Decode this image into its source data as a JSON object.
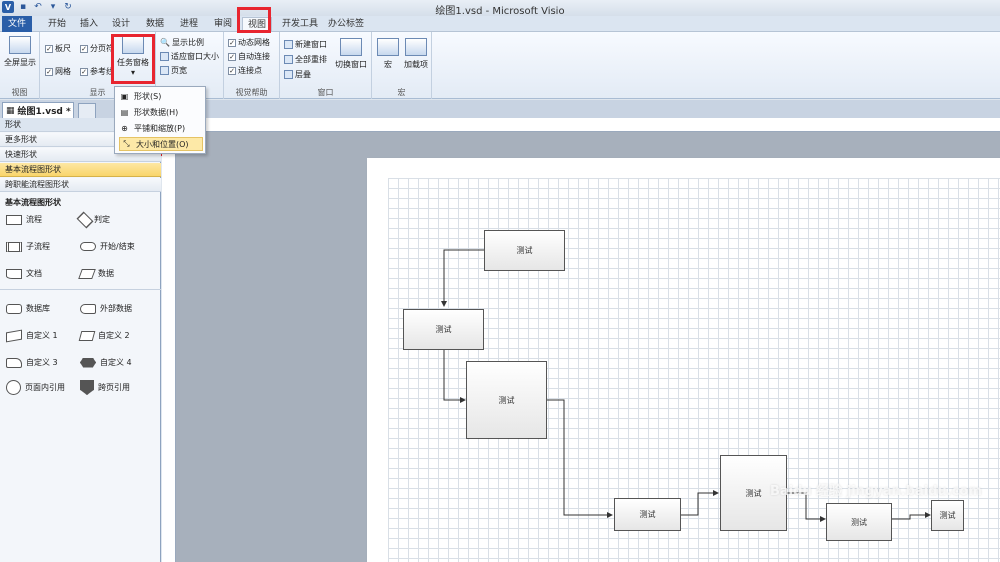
{
  "window": {
    "title": "绘图1.vsd - Microsoft Visio"
  },
  "quick_access": [
    "visio-logo",
    "save-icon",
    "undo-icon",
    "dropdown-icon",
    "redo-icon"
  ],
  "tabs": [
    "文件",
    "开始",
    "插入",
    "设计",
    "数据",
    "进程",
    "审阅",
    "视图",
    "开发工具",
    "办公标签"
  ],
  "active_tab": "视图",
  "ribbon": {
    "view_group": {
      "label": "视图",
      "fullscreen": "全屏显示"
    },
    "show_group": {
      "label": "显示",
      "ruler": "板尺",
      "pagebreak": "分页符",
      "grid": "网格",
      "guides": "参考线"
    },
    "task_pane": {
      "label": "任务窗格"
    },
    "zoom_group": {
      "zoom": "显示比例",
      "fit_window": "适应窗口大小",
      "page_width": "页宽"
    },
    "visual_aids": {
      "label": "视觉帮助",
      "snap": "动态网格",
      "autoconnect": "自动连接",
      "connection_points": "连接点"
    },
    "window_group": {
      "label": "窗口",
      "new_window": "新建窗口",
      "arrange_all": "全部重排",
      "cascade": "层叠",
      "switch": "切换窗口"
    },
    "macro_group": {
      "label": "宏",
      "macro": "宏",
      "addons": "加载项"
    }
  },
  "task_pane_menu": [
    {
      "icon": "shape-icon",
      "label": "形状(S)"
    },
    {
      "icon": "shape-data-icon",
      "label": "形状数据(H)"
    },
    {
      "icon": "pan-zoom-icon",
      "label": "平铺和缩放(P)"
    },
    {
      "icon": "size-position-icon",
      "label": "大小和位置(O)"
    }
  ],
  "document": {
    "tab": "绘图1.vsd *"
  },
  "shapes_panel": {
    "title": "形状",
    "sections": [
      "更多形状",
      "快速形状",
      "基本流程图形状",
      "跨职能流程图形状"
    ],
    "active_section": "基本流程图形状",
    "stencil_title": "基本流程图形状",
    "items": [
      "流程",
      "判定",
      "子流程",
      "开始/结束",
      "文档",
      "数据",
      "数据库",
      "外部数据",
      "自定义 1",
      "自定义 2",
      "自定义 3",
      "自定义 4",
      "页面内引用",
      "跨页引用"
    ]
  },
  "diagram": {
    "node_label": "测试",
    "nodes": [
      "测试",
      "测试",
      "测试",
      "测试",
      "测试",
      "测试",
      "测试"
    ]
  },
  "watermark": "Baidu 经验 jingyan.baidu.com"
}
